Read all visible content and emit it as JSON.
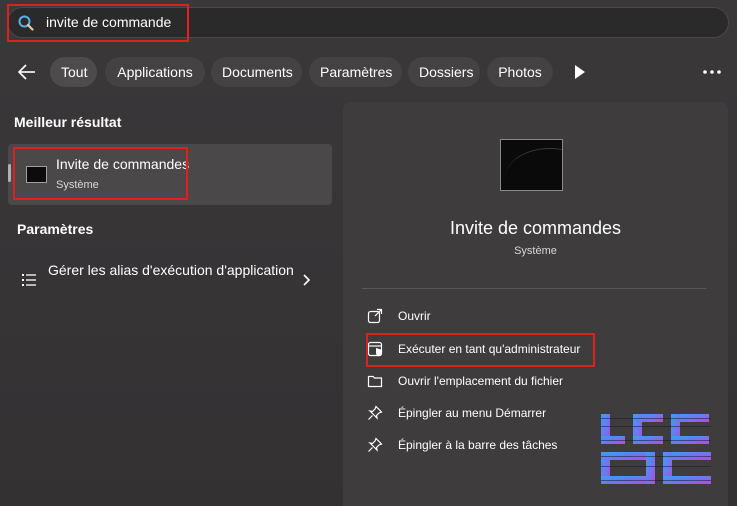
{
  "search": {
    "value": "invite de commande"
  },
  "filters": {
    "items": [
      "Tout",
      "Applications",
      "Documents",
      "Paramètres",
      "Dossiers",
      "Photos"
    ],
    "active": "Tout"
  },
  "best_match": {
    "section_title": "Meilleur résultat",
    "title": "Invite de commandes",
    "subtitle": "Système"
  },
  "settings": {
    "section_title": "Paramètres",
    "item_label": "Gérer les alias d'exécution d'application"
  },
  "detail": {
    "title": "Invite de commandes",
    "subtitle": "Système",
    "actions": [
      "Ouvrir",
      "Exécuter en tant qu'administrateur",
      "Ouvrir l'emplacement du fichier",
      "Épingler au menu Démarrer",
      "Épingler à la barre des tâches"
    ]
  },
  "colors": {
    "highlight": "#e0201f",
    "panel": "#3e3c3d",
    "background": "#363435"
  },
  "icons": [
    "search-icon",
    "back-arrow-icon",
    "play-icon",
    "more-icon",
    "cmd-icon",
    "list-icon",
    "chevron-right-icon",
    "open-icon",
    "admin-shield-icon",
    "folder-icon",
    "pin-icon"
  ],
  "watermark": {
    "text": "LCDC"
  }
}
